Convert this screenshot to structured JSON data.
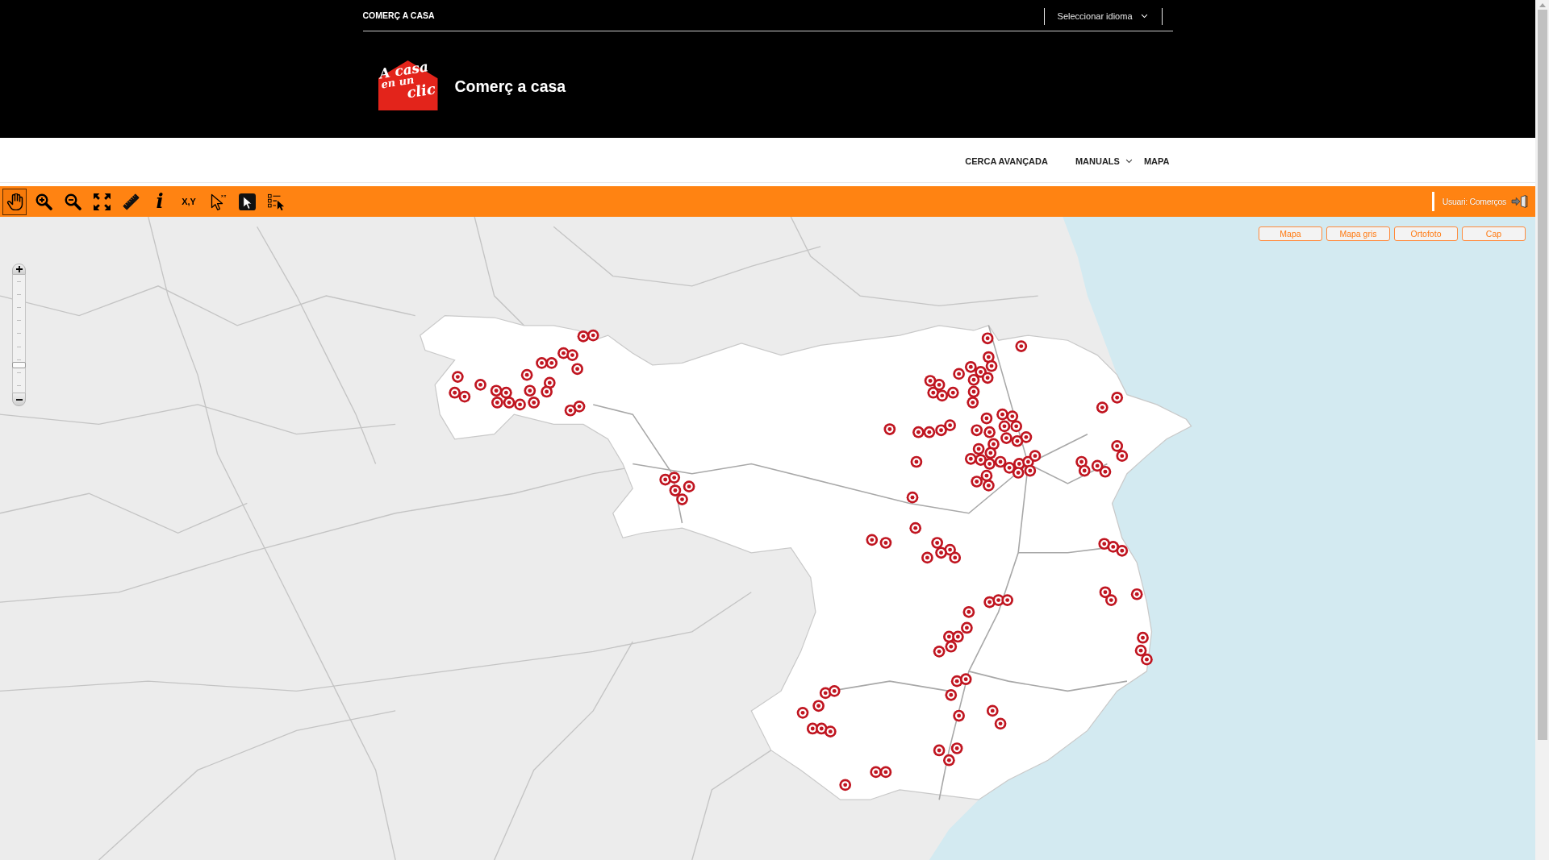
{
  "header": {
    "site_title": "COMERÇ A CASA",
    "language_select": {
      "label": "Seleccionar idioma"
    },
    "logo_lines": [
      "A casa",
      "en un",
      "clic"
    ],
    "brand_name": "Comerç a casa"
  },
  "nav": {
    "items": [
      {
        "label": "CERCA AVANÇADA",
        "has_menu": false
      },
      {
        "label": "MANUALS",
        "has_menu": true
      },
      {
        "label": "MAPA",
        "has_menu": false
      }
    ]
  },
  "toolbar": {
    "tools": [
      {
        "kind": "pan",
        "selected": true
      },
      {
        "kind": "zoom-in",
        "selected": false
      },
      {
        "kind": "zoom-out",
        "selected": false
      },
      {
        "kind": "full-extent",
        "selected": false
      },
      {
        "kind": "measure",
        "selected": false
      },
      {
        "kind": "info",
        "label": "i",
        "selected": false
      },
      {
        "kind": "coordinates",
        "label": "X,Y",
        "selected": false
      },
      {
        "kind": "select-point",
        "selected": false
      },
      {
        "kind": "select-box",
        "selected": false
      },
      {
        "kind": "select-list",
        "selected": false
      }
    ],
    "user": "Usuari: Comerços"
  },
  "map": {
    "base_layers": [
      {
        "label": "Mapa"
      },
      {
        "label": "Mapa gris"
      },
      {
        "label": "Ortofoto"
      },
      {
        "label": "Cap"
      }
    ],
    "zoom_slider": {
      "level": 0.22
    }
  }
}
